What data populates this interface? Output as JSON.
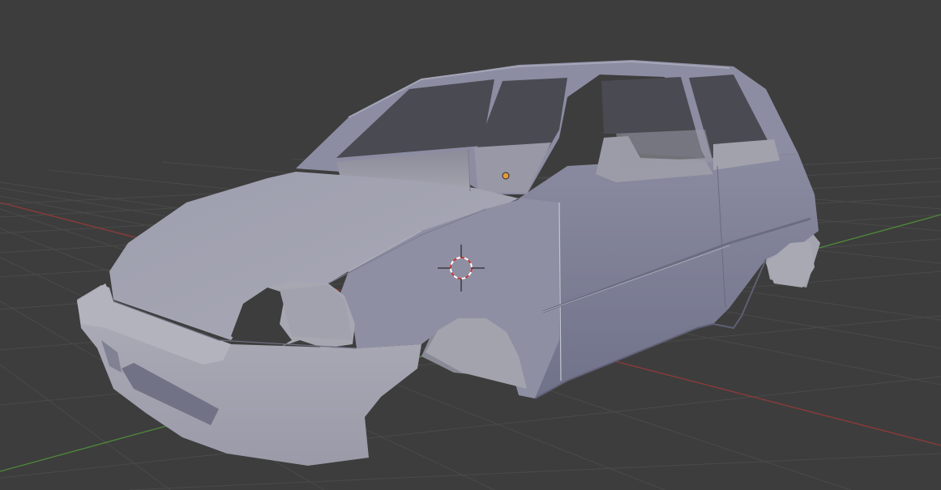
{
  "viewport": {
    "view": "3d-perspective",
    "background_color": "#3d3d3d",
    "grid_color": "#4b4b4b",
    "axis_x_color": "#8f3a3a",
    "axis_y_color": "#4f8a3a",
    "objects": [
      {
        "type": "mesh",
        "description_icon": "car-body-mesh",
        "base_color": "#8e8fa3",
        "shading": "solid-studio"
      }
    ],
    "origin_dot_color": "#e59a3a",
    "cursor_3d": {
      "icon": "3d-cursor-icon",
      "ring_colors": [
        "#c23a3a",
        "#ffffff"
      ]
    }
  }
}
